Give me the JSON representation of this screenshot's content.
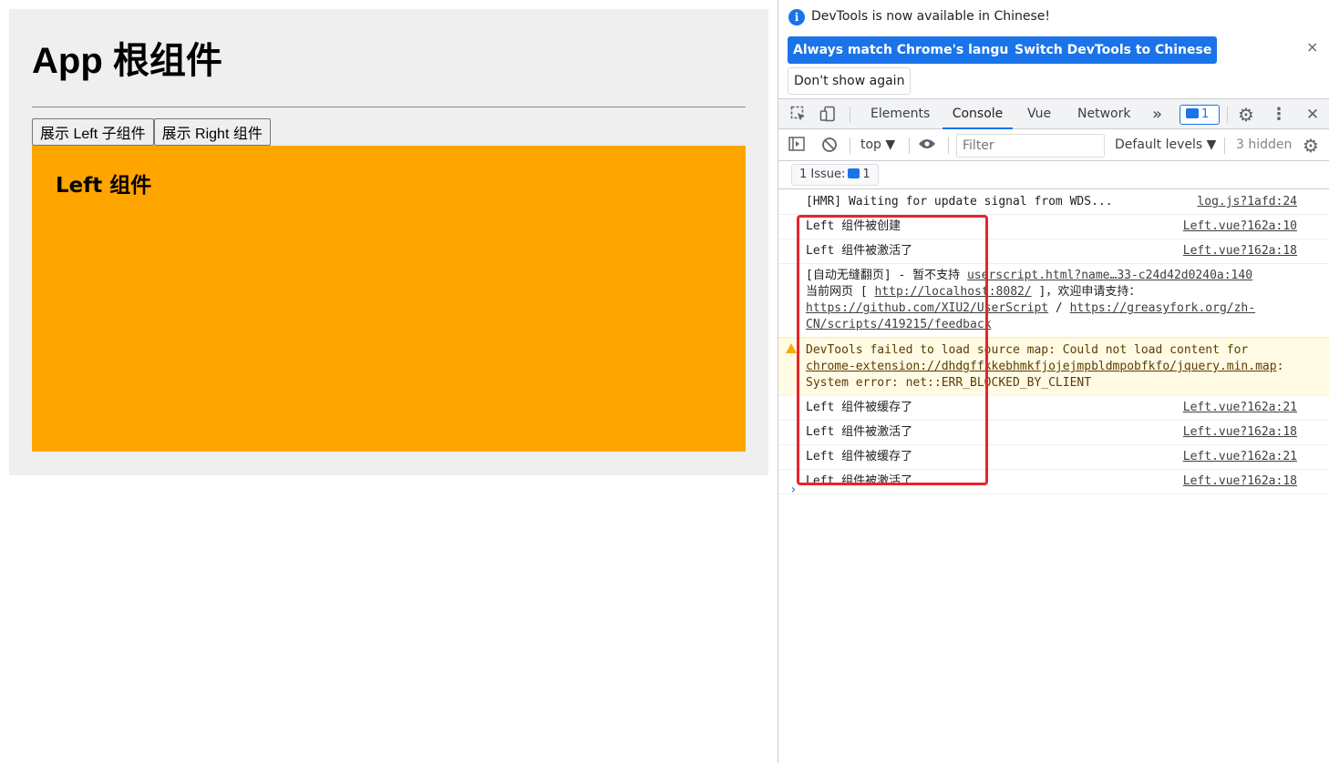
{
  "app": {
    "title": "App 根组件",
    "buttons": [
      "展示 Left 子组件",
      "展示 Right 组件"
    ],
    "left_component_title": "Left 组件",
    "left_component_color": "#ffa500"
  },
  "devtools": {
    "infobar": {
      "icon": "info-icon",
      "message": "DevTools is now available in Chinese!",
      "match_button": "Always match Chrome's language",
      "switch_button": "Switch DevTools to Chinese",
      "dont_show_button": "Don't show again",
      "close": "×"
    },
    "tabs": {
      "elements": "Elements",
      "console": "Console",
      "vue": "Vue",
      "network": "Network",
      "more": "»",
      "issues_count": "1",
      "close": "✕"
    },
    "filterbar": {
      "context": "top ▼",
      "filter_placeholder": "Filter",
      "levels": "Default levels ▼",
      "hidden": "3 hidden"
    },
    "issues_bar": {
      "label": "1 Issue:",
      "count": "1"
    },
    "console_rows": [
      {
        "message": "[HMR] Waiting for update signal from WDS...",
        "source": "log.js?1afd:24"
      },
      {
        "message": "Left 组件被创建",
        "source": "Left.vue?162a:10"
      },
      {
        "message": "Left 组件被激活了",
        "source": "Left.vue?162a:18"
      },
      {
        "message_prefix": "[自动无缝翻页] - 暂不支持",
        "message_line2_start": "当前网页 [ ",
        "local_link": "http://localhost:8082/",
        "message_mid": " ]，欢迎申请支持：",
        "github_link": "https://github.com/XIU2/UserScript",
        "separator": " / ",
        "greasy_link": "https://greasyfork.org/zh-CN/scripts/419215/feedback",
        "source": "userscript.html?name…33-c24d42d0240a:140"
      },
      {
        "warning_prefix": "DevTools failed to load source map: Could not load content for ",
        "warning_link": "chrome-extension://dhdgffkkebhmkfjojejmpbldmpobfkfo/jquery.min.map",
        "warning_suffix": ": System error: net::ERR_BLOCKED_BY_CLIENT"
      },
      {
        "message": "Left 组件被缓存了",
        "source": "Left.vue?162a:21"
      },
      {
        "message": "Left 组件被激活了",
        "source": "Left.vue?162a:18"
      },
      {
        "message": "Left 组件被缓存了",
        "source": "Left.vue?162a:21"
      },
      {
        "message": "Left 组件被激活了",
        "source": "Left.vue?162a:18"
      }
    ],
    "prompt": "›",
    "highlight_color": "#e8242b"
  }
}
